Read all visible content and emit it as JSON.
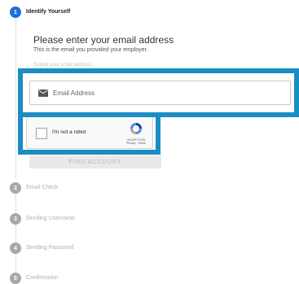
{
  "steps": [
    {
      "number": "1",
      "label": "Identify Yourself"
    },
    {
      "number": "2",
      "label": "Email Check"
    },
    {
      "number": "3",
      "label": "Sending Username"
    },
    {
      "number": "4",
      "label": "Sending Password"
    },
    {
      "number": "5",
      "label": "Confirmation"
    }
  ],
  "form": {
    "heading": "Please enter your email address",
    "subheading": "This is the email you provided your employer.",
    "obscured_label": "Submit your email address",
    "email_placeholder": "Email Address",
    "email_value": "",
    "submit_label": "FIND ACCOUNT"
  },
  "captcha": {
    "label": "I'm not a robot",
    "brand": "reCAPTCHA",
    "terms": "Privacy - Terms",
    "checked": false
  },
  "colors": {
    "active_step": "#1e6fd9",
    "inactive_step": "#a8a8a8",
    "highlight": "#1a8dc4"
  },
  "icons": {
    "email": "envelope-icon",
    "captcha": "recaptcha-logo-icon"
  }
}
